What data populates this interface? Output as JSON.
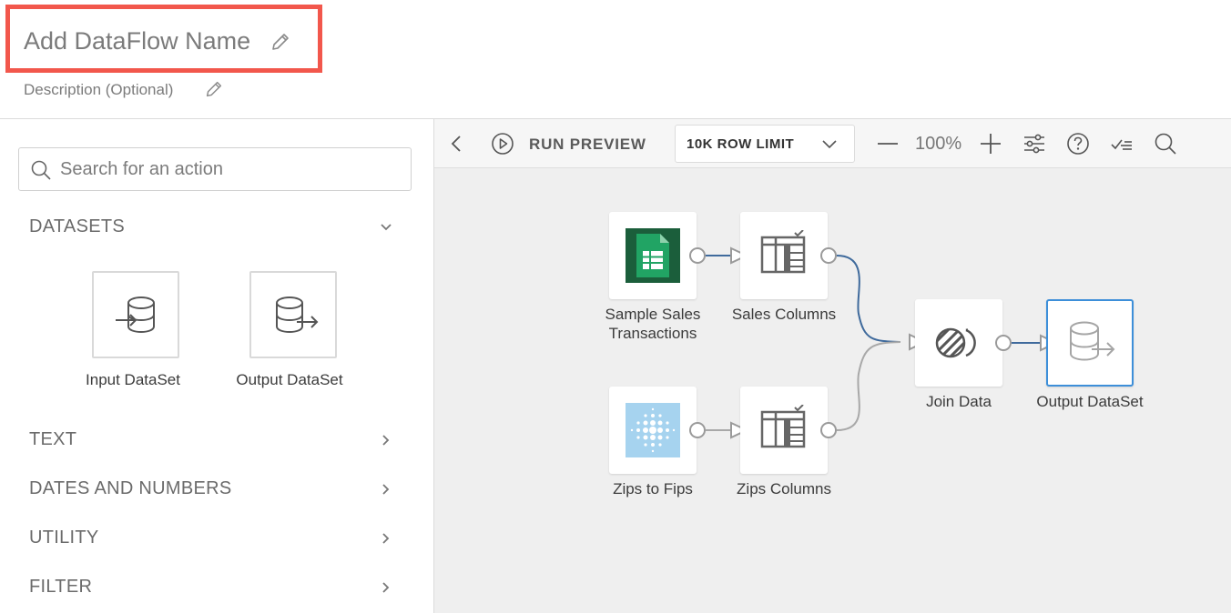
{
  "header": {
    "title": "Add DataFlow Name",
    "description": "Description (Optional)"
  },
  "sidebar": {
    "search_placeholder": "Search for an action",
    "categories": [
      {
        "label": "DATASETS",
        "expanded": true
      },
      {
        "label": "TEXT",
        "expanded": false
      },
      {
        "label": "DATES AND NUMBERS",
        "expanded": false
      },
      {
        "label": "UTILITY",
        "expanded": false
      },
      {
        "label": "FILTER",
        "expanded": false
      }
    ],
    "dataset_tiles": [
      {
        "label": "Input DataSet",
        "icon": "input-dataset-icon"
      },
      {
        "label": "Output DataSet",
        "icon": "output-dataset-icon"
      }
    ]
  },
  "toolbar": {
    "run_preview": "RUN PREVIEW",
    "row_limit": "10K ROW LIMIT",
    "zoom": "100%"
  },
  "canvas": {
    "nodes": [
      {
        "id": "sales",
        "label_line1": "Sample Sales",
        "label_line2": "Transactions",
        "icon": "google-sheets-icon"
      },
      {
        "id": "sales_cols",
        "label": "Sales Columns",
        "icon": "select-columns-icon"
      },
      {
        "id": "zips",
        "label": "Zips to Fips",
        "icon": "dataset-dots-icon"
      },
      {
        "id": "zips_cols",
        "label": "Zips Columns",
        "icon": "select-columns-icon"
      },
      {
        "id": "join",
        "label": "Join Data",
        "icon": "join-icon"
      },
      {
        "id": "output",
        "label": "Output DataSet",
        "icon": "output-dataset-icon",
        "selected": true
      }
    ]
  },
  "colors": {
    "highlight": "#f2574c",
    "link_blue": "#3f6a9c",
    "link_gray": "#a8a8a8",
    "selected_border": "#3d8fd9"
  }
}
